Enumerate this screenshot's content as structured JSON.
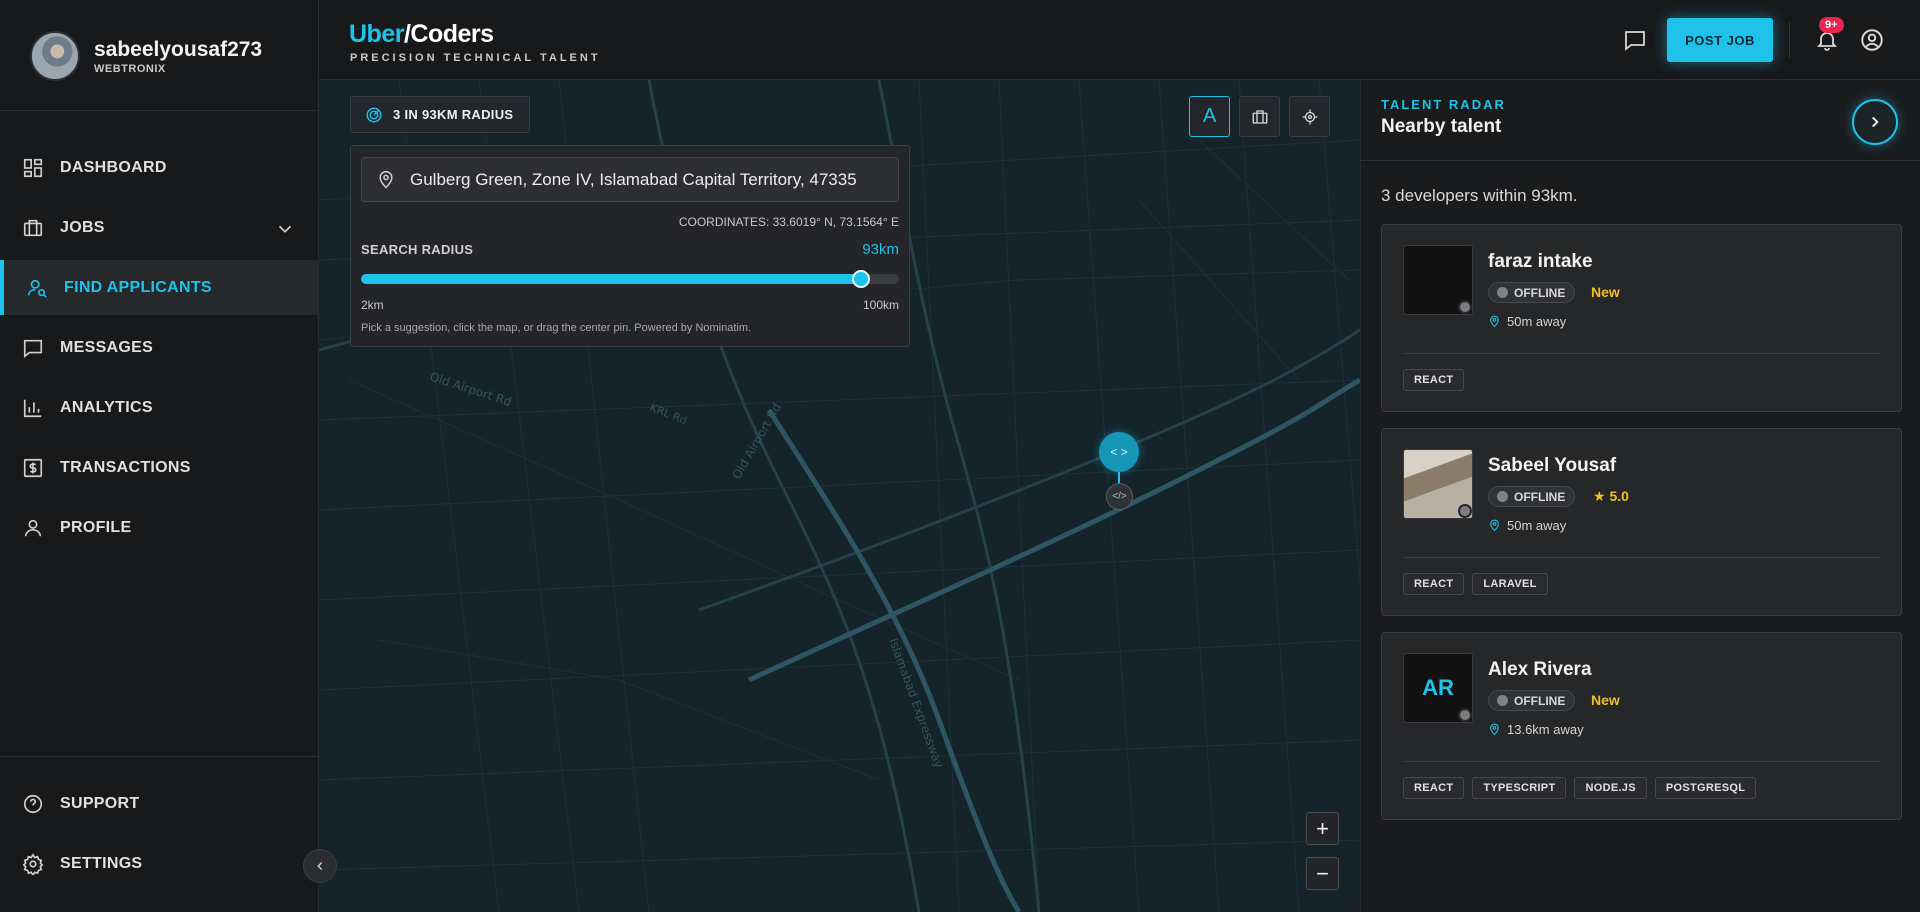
{
  "user": {
    "name": "sabeelyousaf273",
    "org": "WEBTRONIX"
  },
  "nav": {
    "items": [
      {
        "label": "DASHBOARD",
        "icon": "dashboard-icon"
      },
      {
        "label": "JOBS",
        "icon": "briefcase-icon"
      },
      {
        "label": "FIND APPLICANTS",
        "icon": "user-search-icon",
        "active": true
      },
      {
        "label": "MESSAGES",
        "icon": "message-icon"
      },
      {
        "label": "ANALYTICS",
        "icon": "bar-chart-icon"
      },
      {
        "label": "TRANSACTIONS",
        "icon": "dollar-icon"
      },
      {
        "label": "PROFILE",
        "icon": "user-icon"
      }
    ],
    "bottom": [
      {
        "label": "SUPPORT",
        "icon": "help-icon"
      },
      {
        "label": "SETTINGS",
        "icon": "gear-icon"
      }
    ]
  },
  "header": {
    "brand_part1": "Uber",
    "brand_part2": "/Coders",
    "tagline": "PRECISION TECHNICAL TALENT",
    "post_job": "POST JOB",
    "notifications_badge": "9+"
  },
  "map": {
    "radius_chip": "3 IN 93KM RADIUS",
    "location_value": "Gulberg Green, Zone IV, Islamabad Capital Territory, 47335",
    "coordinates": "COORDINATES: 33.6019° N, 73.1564° E",
    "radius_label": "SEARCH RADIUS",
    "radius_value": "93km",
    "radius_km": 93,
    "radius_min_km": 2,
    "radius_max_km": 100,
    "radius_min": "2km",
    "radius_max": "100km",
    "hint": "Pick a suggestion, click the map, or drag the center pin. Powered by Nominatim.",
    "tool_a_label": "A",
    "zoom_in": "+",
    "zoom_out": "−",
    "pin_glyph": "< >",
    "pin_base_glyph": "</>",
    "road_labels": [
      "Old Airport Rd",
      "KRL Rd",
      "Islamabad Expressway",
      "Old Airport Rd"
    ]
  },
  "panel": {
    "kicker": "TALENT RADAR",
    "title": "Nearby talent",
    "summary": "3 developers within 93km.",
    "developers": [
      {
        "name": "faraz intake",
        "status": "OFFLINE",
        "tag": "New",
        "distance": "50m away",
        "skills": [
          "REACT"
        ],
        "initials": ""
      },
      {
        "name": "Sabeel Yousaf",
        "status": "OFFLINE",
        "tag": "★ 5.0",
        "distance": "50m away",
        "skills": [
          "REACT",
          "LARAVEL"
        ],
        "initials": ""
      },
      {
        "name": "Alex Rivera",
        "status": "OFFLINE",
        "tag": "New",
        "distance": "13.6km away",
        "skills": [
          "REACT",
          "TYPESCRIPT",
          "NODE.JS",
          "POSTGRESQL"
        ],
        "initials": "AR"
      }
    ]
  },
  "colors": {
    "accent": "#1fc3ea",
    "tag": "#f0c02b",
    "badge": "#e8264f"
  }
}
